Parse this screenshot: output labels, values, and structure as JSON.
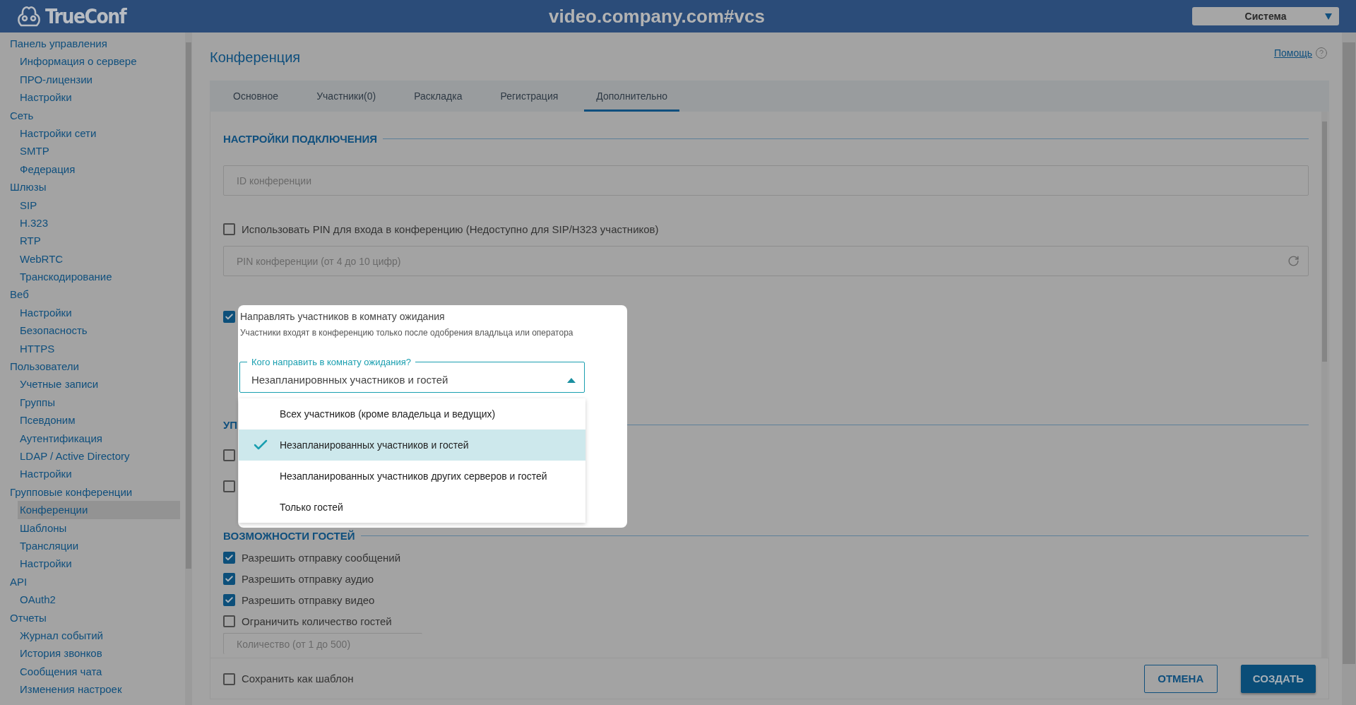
{
  "header": {
    "logo": "TrueConf",
    "title": "video.company.com#vcs",
    "role_select": "Система"
  },
  "sidebar": {
    "items": [
      {
        "label": "Панель управления",
        "selected": false,
        "children": [
          {
            "label": "Информация о сервере",
            "selected": false
          },
          {
            "label": "ПРО-лицензии",
            "selected": false
          },
          {
            "label": "Настройки",
            "selected": false
          }
        ]
      },
      {
        "label": "Сеть",
        "selected": false,
        "children": [
          {
            "label": "Настройки сети",
            "selected": false
          },
          {
            "label": "SMTP",
            "selected": false
          },
          {
            "label": "Федерация",
            "selected": false
          }
        ]
      },
      {
        "label": "Шлюзы",
        "selected": false,
        "children": [
          {
            "label": "SIP",
            "selected": false
          },
          {
            "label": "H.323",
            "selected": false
          },
          {
            "label": "RTP",
            "selected": false
          },
          {
            "label": "WebRTC",
            "selected": false
          },
          {
            "label": "Транскодирование",
            "selected": false
          }
        ]
      },
      {
        "label": "Веб",
        "selected": false,
        "children": [
          {
            "label": "Настройки",
            "selected": false
          },
          {
            "label": "Безопасность",
            "selected": false
          },
          {
            "label": "HTTPS",
            "selected": false
          }
        ]
      },
      {
        "label": "Пользователи",
        "selected": false,
        "children": [
          {
            "label": "Учетные записи",
            "selected": false
          },
          {
            "label": "Группы",
            "selected": false
          },
          {
            "label": "Псевдоним",
            "selected": false
          },
          {
            "label": "Аутентификация",
            "selected": false
          },
          {
            "label": "LDAP / Active Directory",
            "selected": false
          },
          {
            "label": "Настройки",
            "selected": false
          }
        ]
      },
      {
        "label": "Групповые конференции",
        "selected": false,
        "children": [
          {
            "label": "Конференции",
            "selected": true
          },
          {
            "label": "Шаблоны",
            "selected": false
          },
          {
            "label": "Трансляции",
            "selected": false
          },
          {
            "label": "Настройки",
            "selected": false
          }
        ]
      },
      {
        "label": "API",
        "selected": false,
        "children": [
          {
            "label": "OAuth2",
            "selected": false
          }
        ]
      },
      {
        "label": "Отчеты",
        "selected": false,
        "children": [
          {
            "label": "Журнал событий",
            "selected": false
          },
          {
            "label": "История звонков",
            "selected": false
          },
          {
            "label": "Сообщения чата",
            "selected": false
          },
          {
            "label": "Изменения настроек",
            "selected": false
          }
        ]
      }
    ]
  },
  "page": {
    "title": "Конференция",
    "help_link": "Помощь"
  },
  "tabs": [
    {
      "label": "Основное",
      "selected": false
    },
    {
      "label": "Участники(0)",
      "selected": false
    },
    {
      "label": "Раскладка",
      "selected": false
    },
    {
      "label": "Регистрация",
      "selected": false
    },
    {
      "label": "Дополнительно",
      "selected": true
    }
  ],
  "rows": [
    {
      "kind": "heading",
      "text": "НАСТРОЙКИ ПОДКЛЮЧЕНИЯ"
    },
    {
      "kind": "field",
      "placeholder": "ID конференции"
    },
    {
      "kind": "checkbox",
      "label": "Использовать PIN для входа в конференцию (Недоступно для SIP/H323 участников)",
      "checked": false
    },
    {
      "kind": "field",
      "placeholder": "PIN конференции (от 4 до 10 цифр)",
      "refresh": true
    },
    {
      "kind": "waiting_checkbox",
      "checked": true
    },
    {
      "kind": "heading",
      "text": "УП"
    },
    {
      "kind": "checkbox",
      "checked": false
    },
    {
      "kind": "checkbox",
      "checked": false
    },
    {
      "kind": "heading",
      "text": "ВОЗМОЖНОСТИ ГОСТЕЙ"
    },
    {
      "kind": "checkbox",
      "label": "Разрешить отправку сообщений",
      "checked": true
    },
    {
      "kind": "checkbox",
      "label": "Разрешить отправку аудио",
      "checked": true
    },
    {
      "kind": "checkbox",
      "label": "Разрешить отправку видео",
      "checked": true
    },
    {
      "kind": "checkbox",
      "label": "Ограничить количество гостей",
      "checked": false
    },
    {
      "kind": "short_field",
      "placeholder": "Количество (от 1 до 500)"
    }
  ],
  "popup": {
    "label": "Направлять участников в комнату ожидания",
    "hint": "Участники входят в конференцию только после одобрения владльца или оператора",
    "select": {
      "legend": "Кого направить в комнату ожидания?",
      "value": "Незапланировнных участников и гостей",
      "expanded": true
    },
    "options": [
      {
        "label": "Всех участников (кроме владельца и ведущих)",
        "selected": false
      },
      {
        "label": "Незапланированных участников и гостей",
        "selected": true
      },
      {
        "label": "Незапланированных участников других серверов и гостей",
        "selected": false
      },
      {
        "label": "Только гостей",
        "selected": false
      }
    ]
  },
  "footer": {
    "save_template": {
      "label": "Сохранить как шаблон",
      "checked": false
    },
    "buttons": [
      {
        "label": "ОТМЕНА",
        "kind": "outline"
      },
      {
        "label": "СОЗДАТЬ",
        "kind": "primary"
      }
    ]
  }
}
